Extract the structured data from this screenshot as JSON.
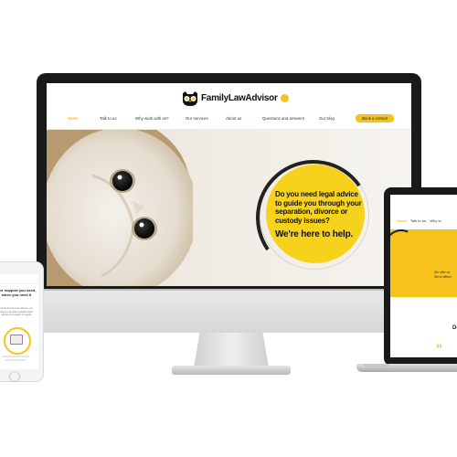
{
  "colors": {
    "accent": "#f7c21b",
    "hero_circle": "#f7d21c",
    "frame": "#1a1a1a"
  },
  "site": {
    "logo_text": "FamilyLawAdvisor",
    "nav": [
      {
        "label": "Home",
        "active": true
      },
      {
        "label": "Talk to us",
        "active": false
      },
      {
        "label": "Why work with us?",
        "active": false
      },
      {
        "label": "Our services",
        "active": false
      },
      {
        "label": "About us",
        "active": false
      },
      {
        "label": "Questions and answers",
        "active": false
      },
      {
        "label": "Our blog",
        "active": false
      }
    ],
    "cta_label": "Book a consult",
    "hero": {
      "question": "Do you need legal advice to guide you through your separation, divorce or custody issues?",
      "tagline": "We're here to help."
    }
  },
  "laptop": {
    "nav": [
      "Home",
      "Talk to us",
      "Why w"
    ],
    "text_line1": "We offer us",
    "text_line2": "We're differe",
    "quote_mark": "“",
    "heading_fragment": "De"
  },
  "phone": {
    "title": "The support you need, when you need it",
    "copy": "At the Family Law Advisor, our lawyers provide separate legal advice and support to people"
  },
  "icons": [
    "owl-logo-icon",
    "owl-photo",
    "phone-home-button-icon",
    "phone-document-icon"
  ]
}
